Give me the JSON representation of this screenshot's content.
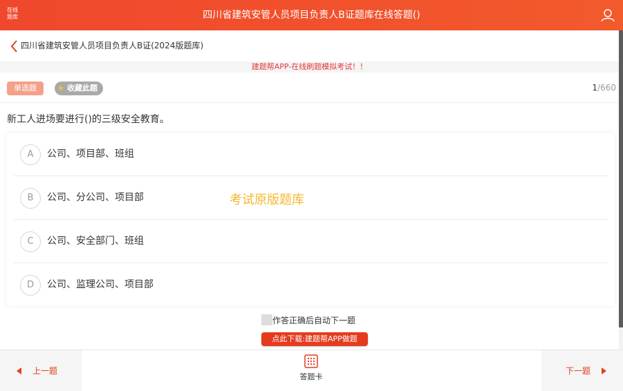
{
  "header": {
    "logo_line1": "在线",
    "logo_line2": "题库",
    "title": "四川省建筑安管人员项目负责人B证题库在线答题()"
  },
  "breadcrumb": {
    "text": "四川省建筑安管人员项目负责人B证(2024版题库)"
  },
  "promo": "建题帮APP-在线刷题模拟考试！！",
  "question_meta": {
    "type_label": "单选题",
    "favorite_label": "收藏此题",
    "current": "1",
    "total": "/660"
  },
  "question": {
    "text": "新工人进场要进行()的三级安全教育。",
    "options": [
      {
        "letter": "A",
        "text": "公司、项目部、班组"
      },
      {
        "letter": "B",
        "text": "公司、分公司、项目部"
      },
      {
        "letter": "C",
        "text": "公司、安全部门、班组"
      },
      {
        "letter": "D",
        "text": "公司、监理公司、项目部"
      }
    ],
    "watermark": "考试原版题库"
  },
  "auto_next_label": "作答正确后自动下一题",
  "download_label": "点此下载:建题帮APP做题",
  "footer": {
    "prev_label": "上一题",
    "card_label": "答题卡",
    "next_label": "下一题"
  },
  "colors": {
    "brand": "#f0472d",
    "accent_red": "#e43b1f",
    "tag_orange": "#f4a08a",
    "watermark": "#f5b82e"
  },
  "icons": {
    "user": "user-icon",
    "back": "chevron-left-icon",
    "star": "star-icon",
    "card": "answer-card-grid-icon"
  }
}
